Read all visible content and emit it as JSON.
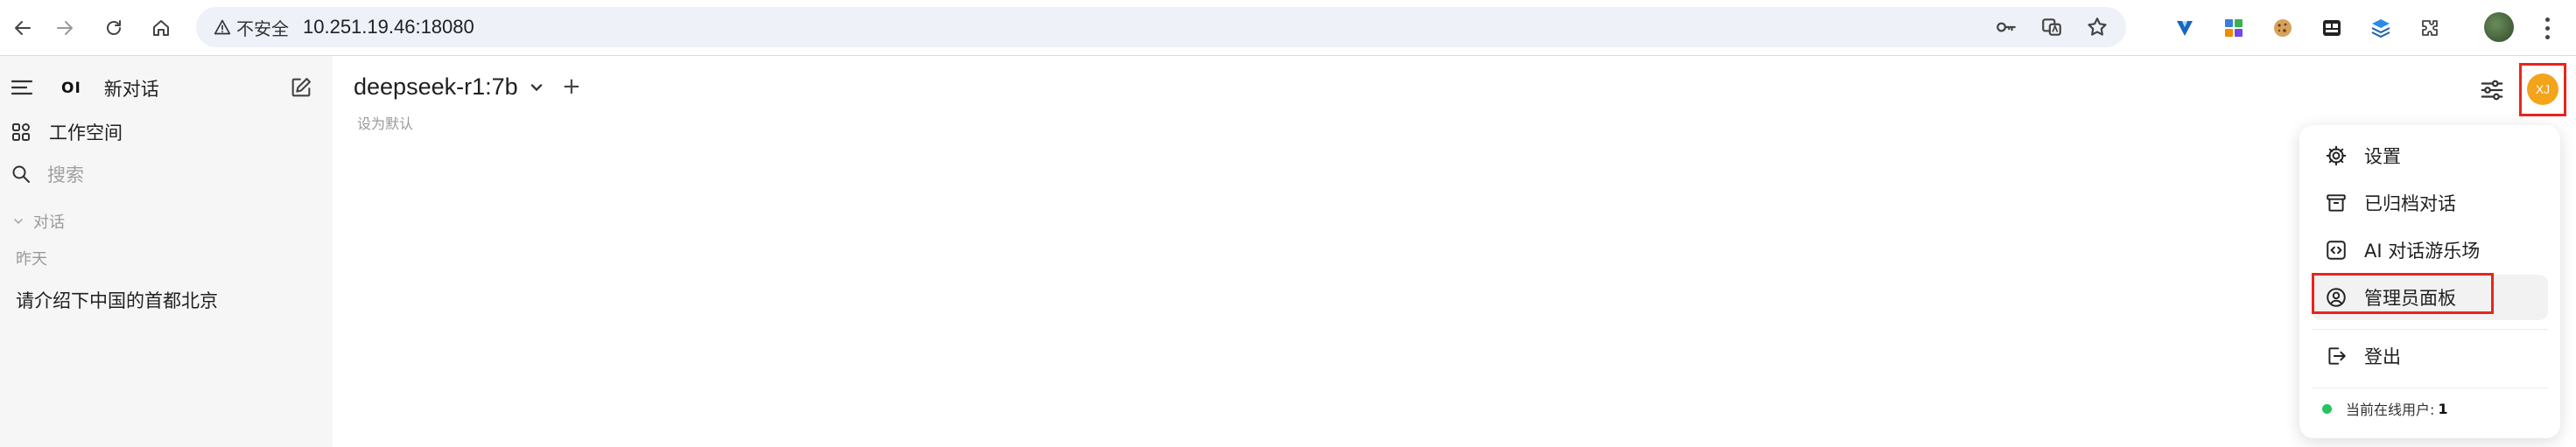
{
  "browser": {
    "security_label": "不安全",
    "url": "10.251.19.46:18080",
    "nav_icons": [
      "back-icon",
      "forward-icon",
      "reload-icon",
      "home-icon"
    ],
    "omnibox_icons": [
      "key-icon",
      "translate-icon",
      "star-icon"
    ],
    "extension_icons": [
      "vuetify-icon",
      "apps-grid-icon",
      "cookie-icon",
      "media-icon",
      "layers-icon",
      "extensions-puzzle-icon"
    ]
  },
  "sidebar": {
    "brand": "OI",
    "new_chat": "新对话",
    "workspace": "工作空间",
    "search_placeholder": "搜索",
    "section_chats": "对话",
    "group_yesterday": "昨天",
    "chats": [
      {
        "title": "请介绍下中国的首都北京"
      }
    ]
  },
  "main": {
    "model_name": "deepseek-r1:7b",
    "set_default": "设为默认",
    "add_model": "+",
    "avatar_initials": "XJ"
  },
  "user_menu": {
    "items": [
      {
        "label": "设置",
        "icon": "gear-icon"
      },
      {
        "label": "已归档对话",
        "icon": "archive-icon"
      },
      {
        "label": "AI 对话游乐场",
        "icon": "code-icon"
      },
      {
        "label": "管理员面板",
        "icon": "user-circle-icon"
      },
      {
        "label": "登出",
        "icon": "logout-icon"
      }
    ],
    "online_label": "当前在线用户:",
    "online_count": "1"
  },
  "colors": {
    "avatar": "#f4a41a",
    "highlight": "#e8251e",
    "online_dot": "#22c55e",
    "sidebar_bg": "#f6f6f6"
  }
}
